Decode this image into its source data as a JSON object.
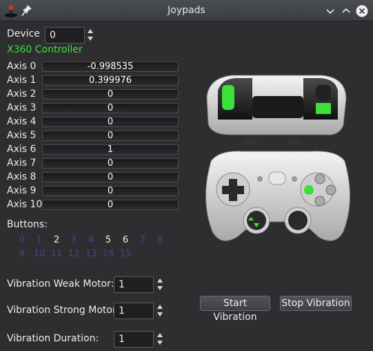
{
  "window": {
    "title": "Joypads",
    "icons": [
      "joystick-app-icon",
      "pin-icon",
      "minimize-icon",
      "maximize-icon",
      "close-icon"
    ]
  },
  "device": {
    "label": "Device",
    "value": "0",
    "name": "X360 Controller"
  },
  "axes": [
    {
      "label": "Axis 0",
      "value": "-0.998535"
    },
    {
      "label": "Axis 1",
      "value": "0.399976"
    },
    {
      "label": "Axis 2",
      "value": "0"
    },
    {
      "label": "Axis 3",
      "value": "0"
    },
    {
      "label": "Axis 4",
      "value": "0"
    },
    {
      "label": "Axis 5",
      "value": "0"
    },
    {
      "label": "Axis 6",
      "value": "1"
    },
    {
      "label": "Axis 7",
      "value": "0"
    },
    {
      "label": "Axis 8",
      "value": "0"
    },
    {
      "label": "Axis 9",
      "value": "0"
    },
    {
      "label": "Axis 10",
      "value": "0"
    }
  ],
  "buttons": {
    "label": "Buttons:",
    "items": [
      {
        "n": "0",
        "pressed": false
      },
      {
        "n": "1",
        "pressed": false
      },
      {
        "n": "2",
        "pressed": true
      },
      {
        "n": "3",
        "pressed": false
      },
      {
        "n": "4",
        "pressed": false
      },
      {
        "n": "5",
        "pressed": true
      },
      {
        "n": "6",
        "pressed": true
      },
      {
        "n": "7",
        "pressed": false
      },
      {
        "n": "8",
        "pressed": false
      },
      {
        "n": "9",
        "pressed": false
      },
      {
        "n": "10",
        "pressed": false
      },
      {
        "n": "11",
        "pressed": false
      },
      {
        "n": "12",
        "pressed": false
      },
      {
        "n": "13",
        "pressed": false
      },
      {
        "n": "14",
        "pressed": false
      },
      {
        "n": "15",
        "pressed": false
      }
    ]
  },
  "vibration": {
    "weak_label": "Vibration Weak Motor:",
    "weak_value": "1",
    "strong_label": "Vibration Strong Motor:",
    "strong_value": "1",
    "duration_label": "Vibration Duration:",
    "duration_value": "1",
    "start_label": "Start Vibration",
    "stop_label": "Stop Vibration"
  },
  "colors": {
    "highlight": "#39e23a",
    "pressed_button": "#f2f2f2",
    "idle_button": "#4a3f8e"
  }
}
